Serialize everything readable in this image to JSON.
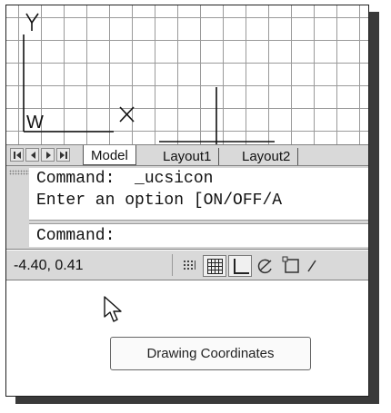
{
  "tabs": {
    "model": "Model",
    "layout1": "Layout1",
    "layout2": "Layout2"
  },
  "ucs_icon": {
    "axis_y": "Y",
    "world_marker": "W"
  },
  "command": {
    "line1": "Command:  _ucsicon",
    "line2": "Enter an option [ON/OFF/A",
    "prompt": "Command:"
  },
  "status": {
    "coordinates": "-4.40, 0.41"
  },
  "tooltip": {
    "text": "Drawing Coordinates"
  },
  "icons": [
    "first-tab-icon",
    "prev-tab-icon",
    "next-tab-icon",
    "last-tab-icon",
    "snap-icon",
    "grid-icon",
    "ortho-icon",
    "polar-icon",
    "osnap-icon",
    "otrack-icon",
    "arrow-cursor-icon"
  ]
}
